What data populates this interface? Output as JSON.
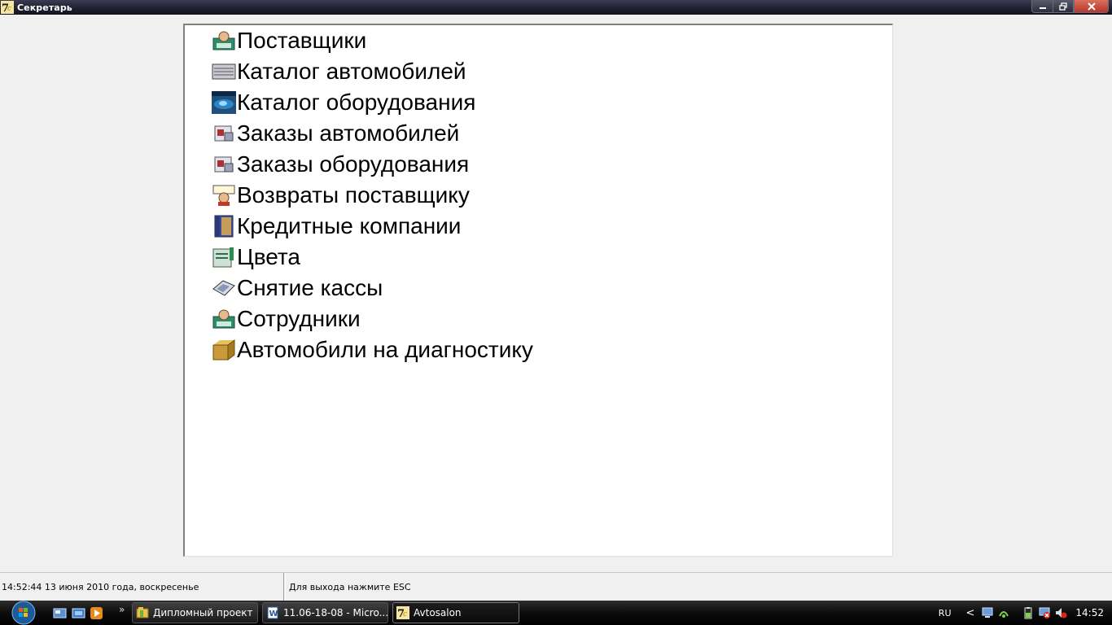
{
  "window": {
    "title": "Секретарь"
  },
  "menu": {
    "items": [
      {
        "label": "Поставщики",
        "icon": "suppliers-icon"
      },
      {
        "label": "Каталог автомобилей",
        "icon": "car-catalog-icon"
      },
      {
        "label": "Каталог оборудования",
        "icon": "equipment-catalog-icon"
      },
      {
        "label": "Заказы автомобилей",
        "icon": "car-orders-icon"
      },
      {
        "label": "Заказы оборудования",
        "icon": "equipment-orders-icon"
      },
      {
        "label": "Возвраты поставщику",
        "icon": "supplier-returns-icon"
      },
      {
        "label": "Кредитные компании",
        "icon": "credit-companies-icon"
      },
      {
        "label": "Цвета",
        "icon": "colors-icon"
      },
      {
        "label": "Снятие кассы",
        "icon": "cash-register-icon"
      },
      {
        "label": "Сотрудники",
        "icon": "employees-icon"
      },
      {
        "label": "Автомобили на диагностику",
        "icon": "diagnostics-box-icon"
      }
    ]
  },
  "status": {
    "datetime": "14:52:44  13 июня 2010 года, воскресенье",
    "hint": "Для выхода нажмите ESC"
  },
  "taskbar": {
    "chevron": "»",
    "buttons": [
      {
        "label": "Дипломный проект"
      },
      {
        "label": "11.06-18-08 - Micro..."
      },
      {
        "label": "Avtosalon"
      }
    ],
    "tray": {
      "lang": "RU",
      "expand": "<",
      "clock": "14:52"
    }
  },
  "colors": {
    "titlebar": "#1e1e30",
    "panel": "#ffffff",
    "background": "#f0f0f0",
    "taskbar": "#0c0c0c"
  }
}
